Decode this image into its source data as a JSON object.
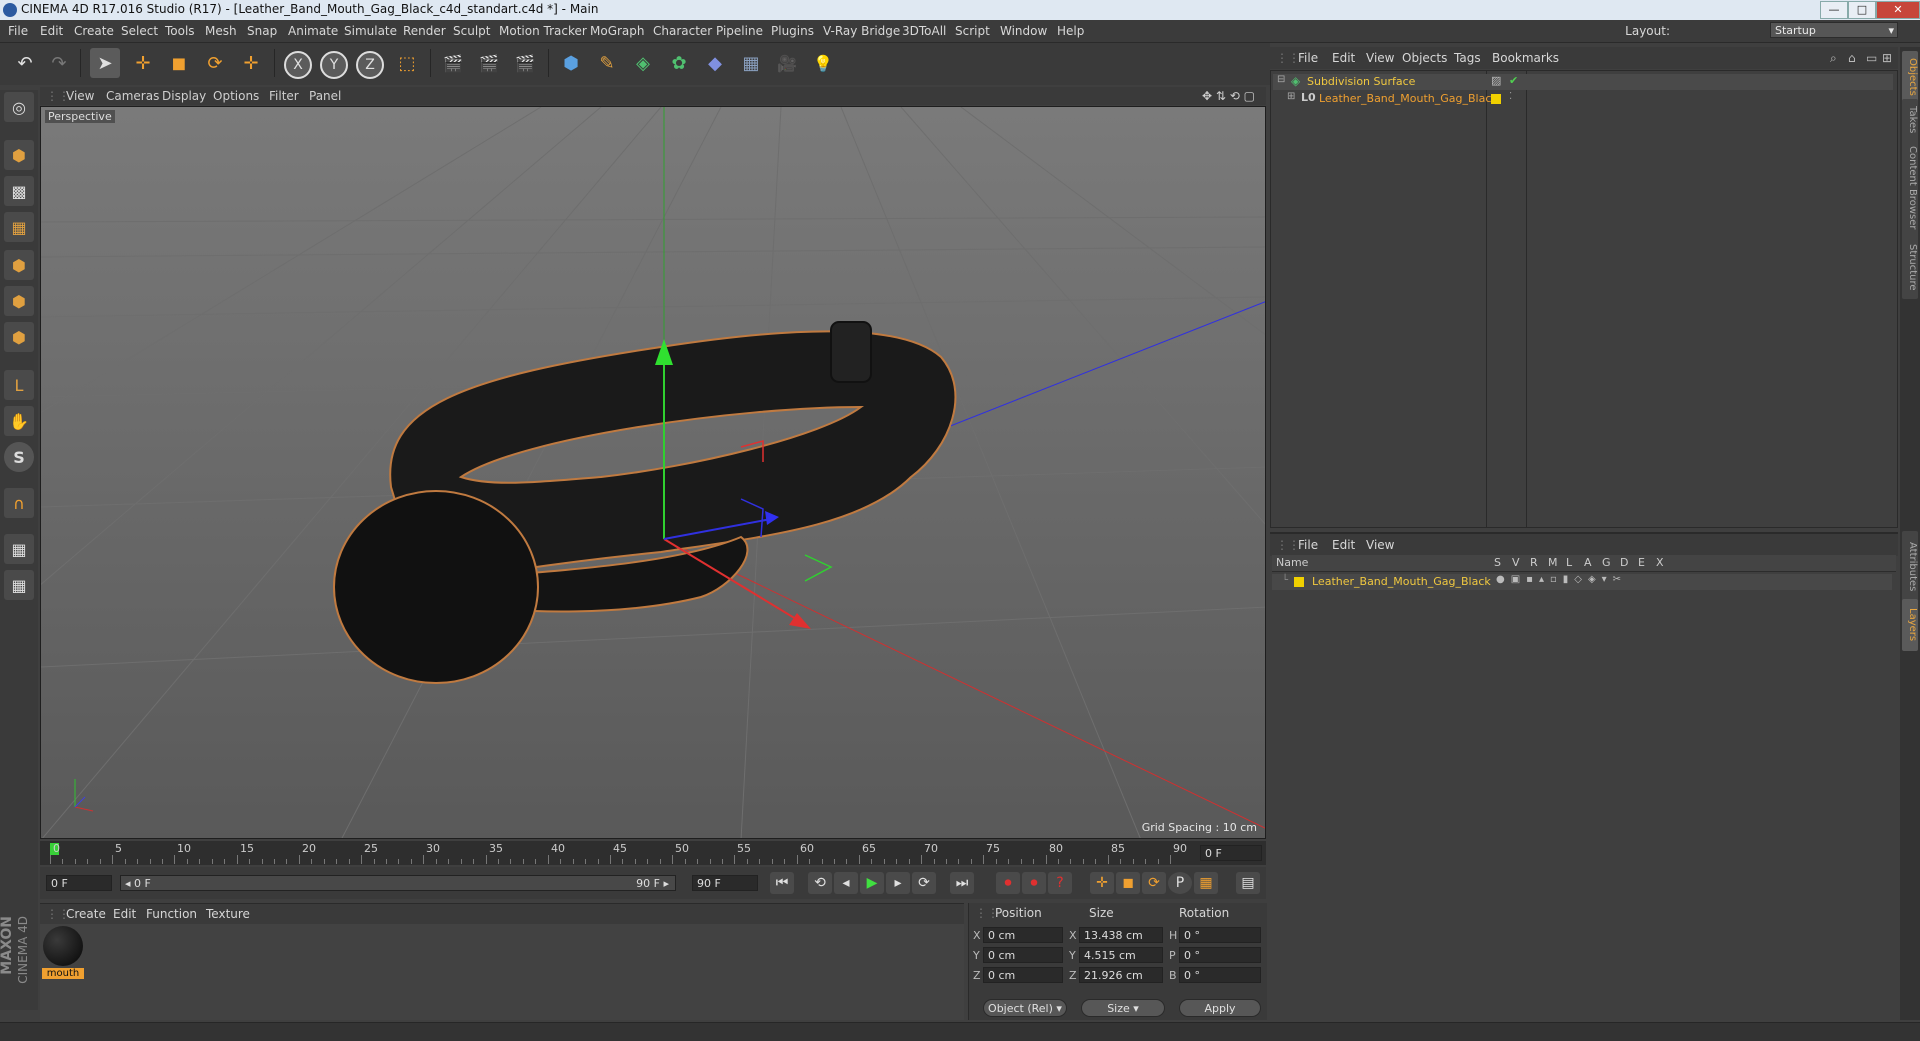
{
  "window": {
    "title": "CINEMA 4D R17.016 Studio (R17) - [Leather_Band_Mouth_Gag_Black_c4d_standart.c4d *] - Main",
    "minimize": "—",
    "maximize": "□",
    "close": "✕"
  },
  "menubar": {
    "items": [
      "File",
      "Edit",
      "Create",
      "Select",
      "Tools",
      "Mesh",
      "Snap",
      "Animate",
      "Simulate",
      "Render",
      "Sculpt",
      "Motion Tracker",
      "MoGraph",
      "Character",
      "Pipeline",
      "Plugins",
      "V-Ray Bridge",
      "3DToAll",
      "Script",
      "Window",
      "Help"
    ],
    "layout_label": "Layout:",
    "layout_value": "Startup"
  },
  "toolbar": {
    "undo": "↶",
    "redo": "↷",
    "select": "➤",
    "move": "✛",
    "scale": "◼",
    "rotate": "⟳",
    "live": "✛",
    "x": "X",
    "y": "Y",
    "z": "Z",
    "coord": "⬚",
    "render_view": "🎬",
    "render_pic": "🎬",
    "render_settings": "🎬",
    "cube": "⬢",
    "pen": "✎",
    "nurbs": "◈",
    "array": "✿",
    "deformer": "◆",
    "floor": "▦",
    "camera": "🎥",
    "light": "💡"
  },
  "left_toolbar": [
    "◎",
    "⬢",
    "▩",
    "▦",
    "⬢",
    "⬢",
    "⬢",
    "L",
    "✋",
    "S",
    "∩",
    "▦",
    "▦"
  ],
  "viewport": {
    "menu": [
      "View",
      "Cameras",
      "Display",
      "Options",
      "Filter",
      "Panel"
    ],
    "label": "Perspective",
    "grid_spacing": "Grid Spacing : 10 cm",
    "nav_icons": "✥ ⇅ ⟲ ▢"
  },
  "timeline": {
    "ticks": [
      "0",
      "5",
      "10",
      "15",
      "20",
      "25",
      "30",
      "35",
      "40",
      "45",
      "50",
      "55",
      "60",
      "65",
      "70",
      "75",
      "80",
      "85",
      "90"
    ],
    "end_field": "0 F",
    "current_frame": "0 F",
    "range_start": "◂ 0 F",
    "range_end": "90 F ▸",
    "max_frame": "90 F",
    "buttons": [
      "⏮",
      "⟲",
      "◂",
      "▶",
      "▸",
      "⟳",
      "⏭",
      "⏺",
      "⏺",
      "?",
      "✛",
      "◼",
      "⟳",
      "P",
      "▦",
      "▤"
    ]
  },
  "material_manager": {
    "menu": [
      "Create",
      "Edit",
      "Function",
      "Texture"
    ],
    "material_name": "mouth"
  },
  "coords": {
    "headers": [
      "Position",
      "Size",
      "Rotation"
    ],
    "rows": [
      {
        "axis": "X",
        "pos": "0 cm",
        "size_axis": "X",
        "size": "13.438 cm",
        "rot_axis": "H",
        "rot": "0 °"
      },
      {
        "axis": "Y",
        "pos": "0 cm",
        "size_axis": "Y",
        "size": "4.515 cm",
        "rot_axis": "P",
        "rot": "0 °"
      },
      {
        "axis": "Z",
        "pos": "0 cm",
        "size_axis": "Z",
        "size": "21.926 cm",
        "rot_axis": "B",
        "rot": "0 °"
      }
    ],
    "mode": "Object (Rel)",
    "size_mode": "Size",
    "apply": "Apply"
  },
  "object_manager": {
    "menu": [
      "File",
      "Edit",
      "View",
      "Objects",
      "Tags",
      "Bookmarks"
    ],
    "objects": [
      {
        "name": "Subdivision Surface"
      },
      {
        "name": "Leather_Band_Mouth_Gag_Black"
      }
    ]
  },
  "layer_manager": {
    "menu": [
      "File",
      "Edit",
      "View"
    ],
    "columns": [
      "Name",
      "S",
      "V",
      "R",
      "M",
      "L",
      "A",
      "G",
      "D",
      "E",
      "X"
    ],
    "layers": [
      {
        "name": "Leather_Band_Mouth_Gag_Black"
      }
    ]
  },
  "side_tabs": [
    "Objects",
    "Takes",
    "Content Browser",
    "Structure",
    "Attributes",
    "Layers"
  ],
  "branding": {
    "maxon": "MAXON",
    "cinema": "CINEMA 4D"
  },
  "colors": {
    "accent": "#f0a030",
    "layer_yellow": "#f0d000",
    "viewport_bg": "#5e5e5e"
  }
}
